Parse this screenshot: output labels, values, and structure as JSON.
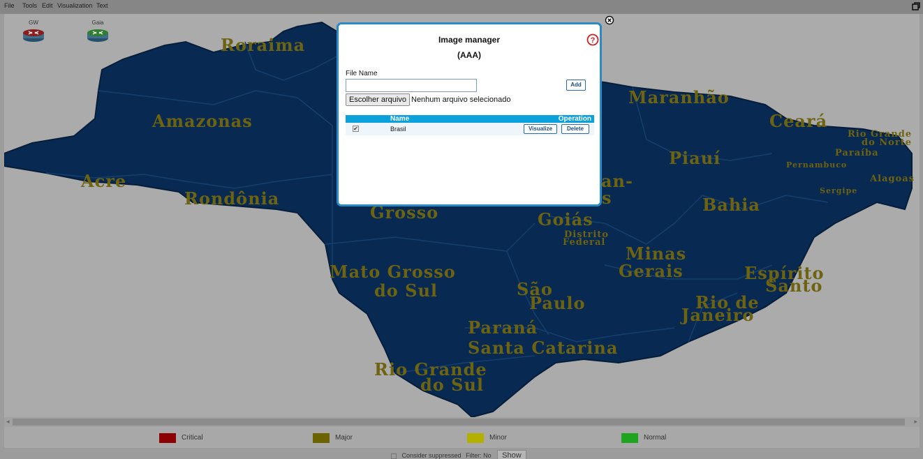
{
  "menu": {
    "items": [
      "File",
      "Tools",
      "Edit",
      "Visualization",
      "Text"
    ]
  },
  "nodes": [
    {
      "name": "GW",
      "status_color": "#8a1e1e"
    },
    {
      "name": "Gaia",
      "status_color": "#2f7f2f"
    }
  ],
  "map": {
    "states": [
      "Roraima",
      "Amazonas",
      "Acre",
      "Rondônia",
      "Grosso",
      "Mato Grosso",
      "do Sul",
      "Goiás",
      "Distrito",
      "Federal",
      "Minas",
      "Gerais",
      "São",
      "Paulo",
      "Paraná",
      "Santa Catarina",
      "Rio Grande",
      "do Sul",
      "Maranhão",
      "Ceará",
      "Rio Grande",
      "do Norte",
      "Paraíba",
      "Pernambuco",
      "Alagoas",
      "Sergipe",
      "Piauí",
      "Bahia",
      "Espírito",
      "Santo",
      "Rio de",
      "Janeiro",
      "an-",
      "s"
    ],
    "land_color": "#082a52",
    "label_color": "#6e6310"
  },
  "legend": [
    {
      "label": "Critical",
      "color": "#8b0000"
    },
    {
      "label": "Major",
      "color": "#6b6300"
    },
    {
      "label": "Minor",
      "color": "#b4b000"
    },
    {
      "label": "Normal",
      "color": "#1ea41e"
    }
  ],
  "footer": {
    "consider_label": "Consider suppressed",
    "filter_text": "Filter: No",
    "show_label": "Show"
  },
  "modal": {
    "title": "Image manager",
    "subtitle": "(AAA)",
    "file_name_label": "File Name",
    "file_input_value": "",
    "add_label": "Add",
    "choose_button_label": "Escolher arquivo",
    "no_file_text": "Nenhum arquivo selecionado",
    "table": {
      "headers": [
        "Name",
        "Operation"
      ],
      "rows": [
        {
          "checked": "✔",
          "name": "Brasil",
          "visualize_label": "Visualize",
          "delete_label": "Delete"
        }
      ]
    },
    "accent_color": "#2b8ac6",
    "help_icon_color": "#d02020"
  }
}
